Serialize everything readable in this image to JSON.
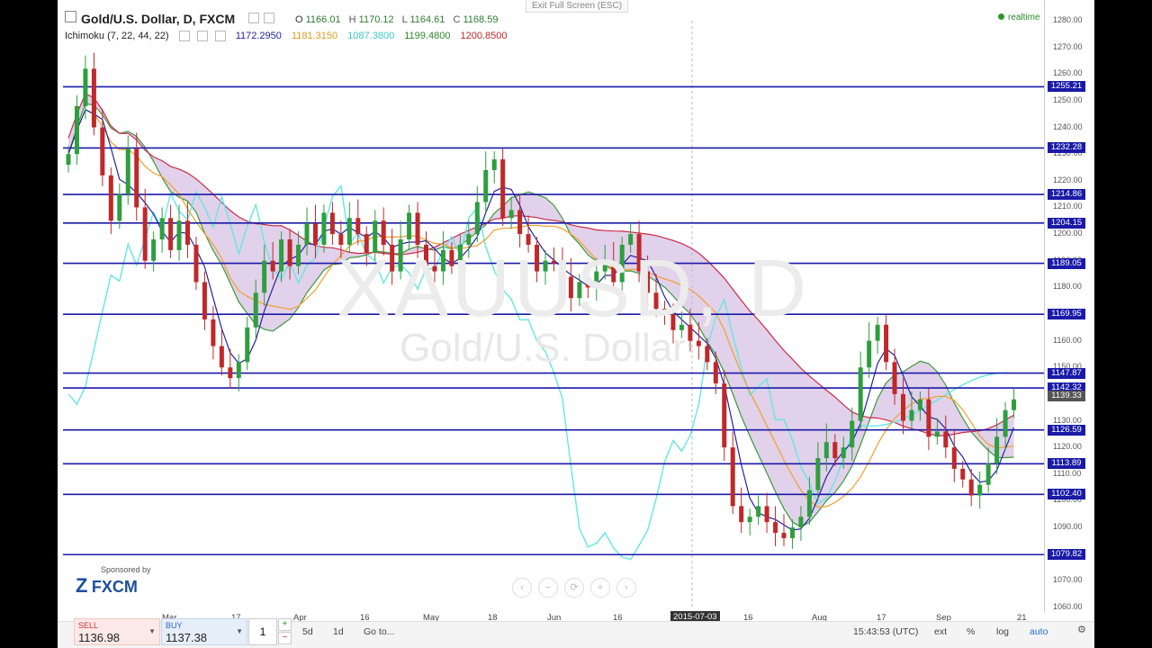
{
  "header": {
    "title": "Gold/U.S. Dollar, D, FXCM",
    "ohlc": {
      "o_label": "O",
      "o": "1166.01",
      "h_label": "H",
      "h": "1170.12",
      "l_label": "L",
      "l": "1164.61",
      "c_label": "C",
      "c": "1168.59"
    },
    "indicator": {
      "name": "Ichimoku (7, 22, 44, 22)",
      "v1": "1172.2950",
      "v2": "1181.3150",
      "v3": "1087.3800",
      "v4": "1199.4800",
      "v5": "1200.8500"
    },
    "exit_fullscreen": "Exit Full Screen (ESC)",
    "realtime": "realtime"
  },
  "watermark": {
    "symbol": "XAUUSD, D",
    "name": "Gold/U.S. Dollar"
  },
  "y_ticks": [
    "1280.00",
    "1270.00",
    "1260.00",
    "1250.00",
    "1240.00",
    "1230.00",
    "1220.00",
    "1210.00",
    "1200.00",
    "1190.00",
    "1180.00",
    "1170.00",
    "1160.00",
    "1150.00",
    "1140.00",
    "1130.00",
    "1120.00",
    "1110.00",
    "1100.00",
    "1090.00",
    "1080.00",
    "1070.00",
    "1060.00"
  ],
  "price_levels": [
    "1255.21",
    "1232.28",
    "1214.86",
    "1204.15",
    "1189.05",
    "1169.95",
    "1147.87",
    "1142.32",
    "1139.33",
    "1126.59",
    "1113.89",
    "1102.40",
    "1079.82"
  ],
  "x_ticks": [
    {
      "label": "Mar"
    },
    {
      "label": "17"
    },
    {
      "label": "Apr"
    },
    {
      "label": "16"
    },
    {
      "label": "May"
    },
    {
      "label": "18"
    },
    {
      "label": "Jun"
    },
    {
      "label": "16"
    },
    {
      "label": "16"
    },
    {
      "label": "Aug"
    },
    {
      "label": "17"
    },
    {
      "label": "Sep"
    },
    {
      "label": "21"
    }
  ],
  "date_highlight": "2015-07-03",
  "sponsor": {
    "line1": "Sponsored by",
    "brand": "FXCM"
  },
  "nav": [
    "‹",
    "−",
    "⟳",
    "+",
    "›"
  ],
  "bottom": {
    "sell_label": "SELL",
    "sell_value": "1136.98",
    "buy_label": "BUY",
    "buy_value": "1137.38",
    "quantity": "1",
    "plus": "+",
    "minus": "−",
    "range1": "5d",
    "range2": "1d",
    "goto": "Go to...",
    "time": "15:43:53 (UTC)",
    "ext": "ext",
    "pct": "%",
    "log": "log",
    "auto": "auto"
  },
  "chart_data": {
    "type": "candlestick",
    "title": "Gold/U.S. Dollar, D, FXCM",
    "ylim": [
      1060,
      1280
    ],
    "horizontal_levels": [
      1255.21,
      1232.28,
      1214.86,
      1204.15,
      1189.05,
      1169.95,
      1147.87,
      1142.32,
      1126.59,
      1113.89,
      1102.4,
      1079.82
    ],
    "last_price": 1139.33,
    "colors": {
      "up": "#2e9e3e",
      "down": "#c0282a",
      "level": "#1a1aa8",
      "tenkan": "#2424a0",
      "kijun": "#f0a030",
      "chikou": "#66e6e6",
      "span_a": "#3a9a3a",
      "span_b": "#cc2a4a",
      "cloud": "#cfb3dc"
    },
    "close_approx": [
      1230,
      1248,
      1262,
      1240,
      1222,
      1205,
      1215,
      1232,
      1210,
      1190,
      1198,
      1206,
      1194,
      1205,
      1196,
      1182,
      1168,
      1158,
      1150,
      1146,
      1152,
      1165,
      1178,
      1190,
      1186,
      1198,
      1188,
      1196,
      1204,
      1196,
      1208,
      1200,
      1196,
      1206,
      1200,
      1193,
      1205,
      1196,
      1186,
      1198,
      1208,
      1196,
      1188,
      1186,
      1194,
      1188,
      1196,
      1200,
      1212,
      1224,
      1228,
      1206,
      1209,
      1200,
      1196,
      1186,
      1190,
      1189,
      1184,
      1176,
      1182,
      1180,
      1186,
      1190,
      1182,
      1196,
      1200,
      1186,
      1178,
      1172,
      1170,
      1164,
      1166,
      1160,
      1158,
      1152,
      1144,
      1120,
      1098,
      1092,
      1094,
      1098,
      1092,
      1088,
      1086,
      1090,
      1094,
      1104,
      1116,
      1122,
      1116,
      1120,
      1130,
      1150,
      1160,
      1166,
      1152,
      1140,
      1130,
      1134,
      1138,
      1124,
      1126,
      1120,
      1112,
      1108,
      1102,
      1106,
      1114,
      1124,
      1134,
      1138
    ]
  }
}
